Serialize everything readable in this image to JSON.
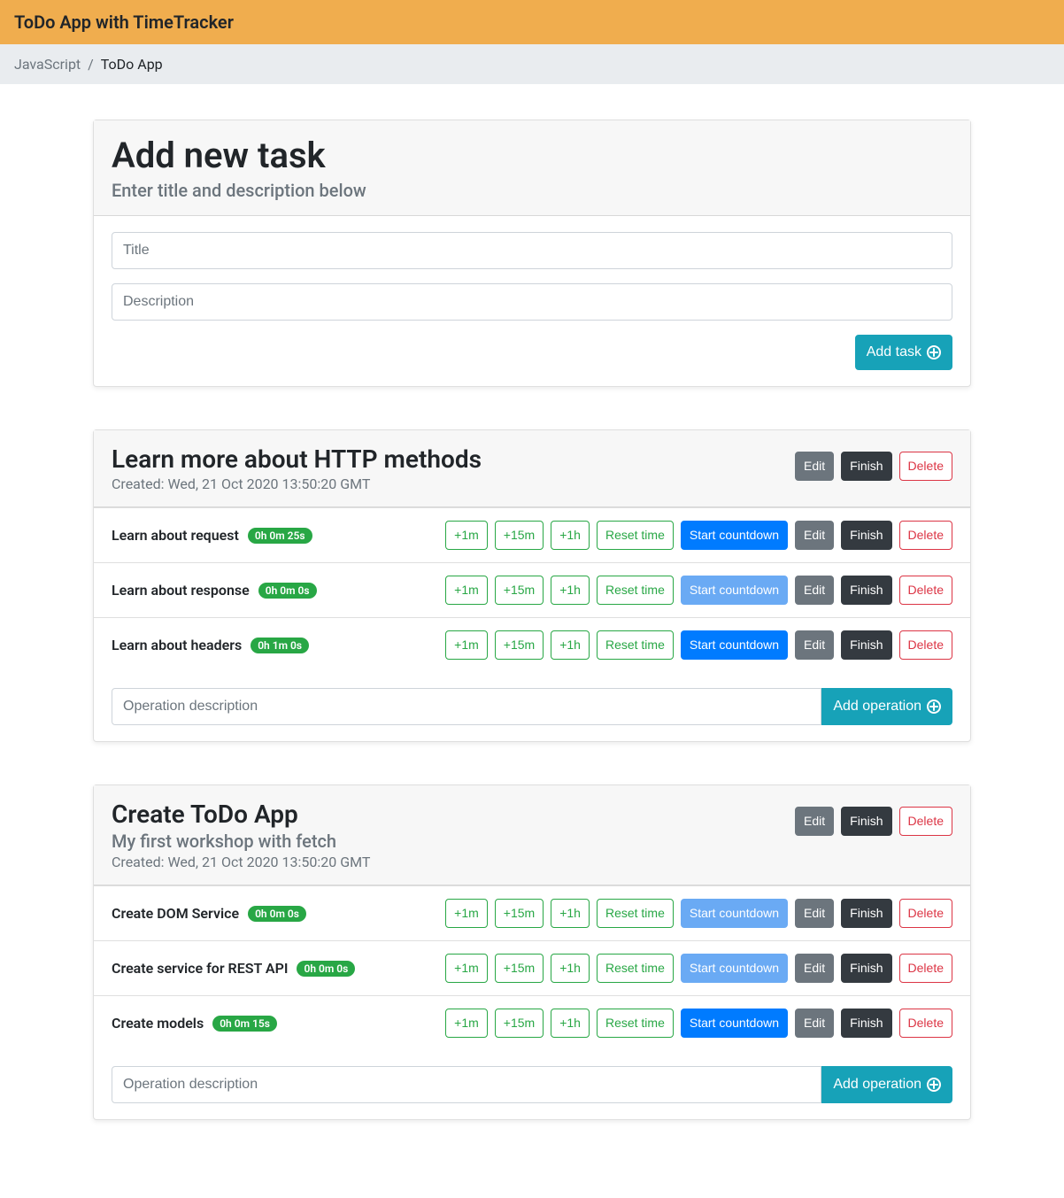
{
  "navbar": {
    "title": "ToDo App with TimeTracker"
  },
  "breadcrumb": {
    "parent": "JavaScript",
    "current": "ToDo App"
  },
  "newTask": {
    "title": "Add new task",
    "subtitle": "Enter title and description below",
    "titlePlaceholder": "Title",
    "descPlaceholder": "Description",
    "addLabel": "Add task"
  },
  "labels": {
    "edit": "Edit",
    "finish": "Finish",
    "delete": "Delete",
    "plus1m": "+1m",
    "plus15m": "+15m",
    "plus1h": "+1h",
    "resetTime": "Reset time",
    "startCountdown": "Start countdown",
    "opPlaceholder": "Operation description",
    "addOperation": "Add operation",
    "createdPrefix": "Created: "
  },
  "tasks": [
    {
      "title": "Learn more about HTTP methods",
      "subtitle": "",
      "created": "Wed, 21 Oct 2020 13:50:20 GMT",
      "operations": [
        {
          "title": "Learn about request",
          "time": "0h 0m 25s",
          "countdownDisabled": false
        },
        {
          "title": "Learn about response",
          "time": "0h 0m 0s",
          "countdownDisabled": true
        },
        {
          "title": "Learn about headers",
          "time": "0h 1m 0s",
          "countdownDisabled": false
        }
      ]
    },
    {
      "title": "Create ToDo App",
      "subtitle": "My first workshop with fetch",
      "created": "Wed, 21 Oct 2020 13:50:20 GMT",
      "operations": [
        {
          "title": "Create DOM Service",
          "time": "0h 0m 0s",
          "countdownDisabled": true
        },
        {
          "title": "Create service for REST API",
          "time": "0h 0m 0s",
          "countdownDisabled": true
        },
        {
          "title": "Create models",
          "time": "0h 0m 15s",
          "countdownDisabled": false
        }
      ]
    }
  ]
}
